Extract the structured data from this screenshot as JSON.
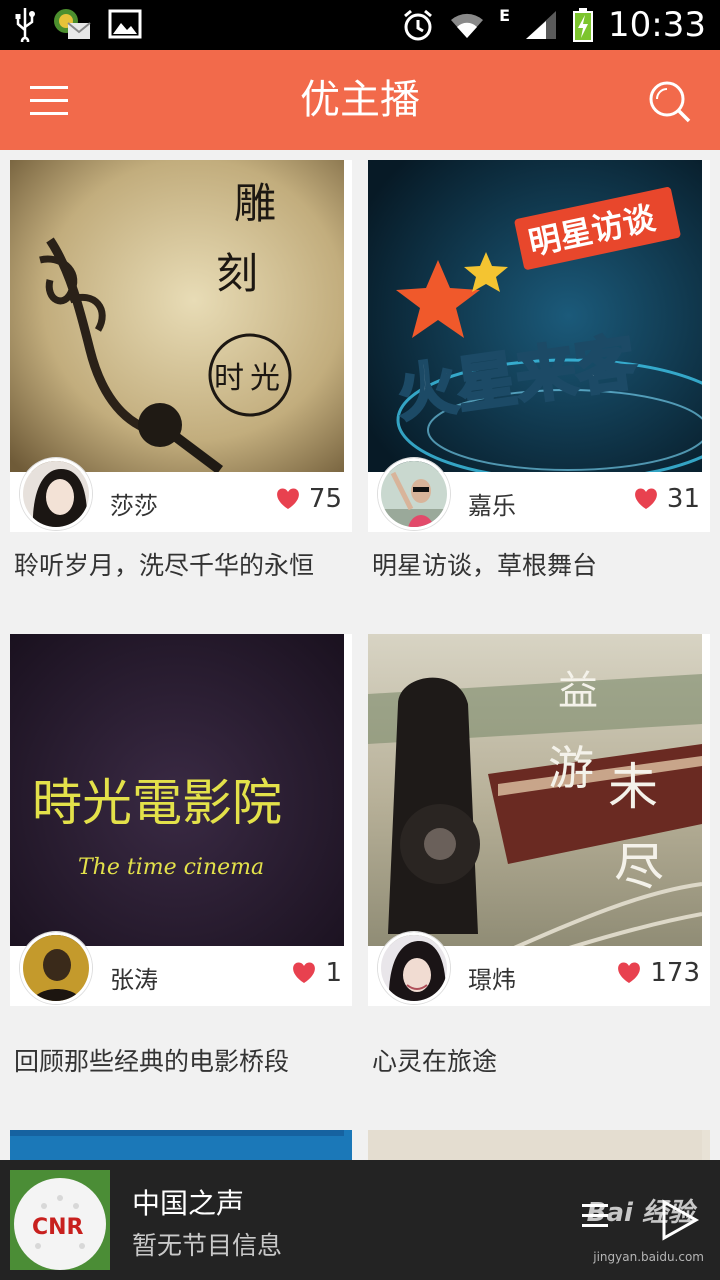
{
  "status_bar": {
    "time": "10:33",
    "network": "E",
    "icons": [
      "usb-icon",
      "mail-icon",
      "gallery-icon",
      "alarm-icon",
      "wifi-icon",
      "signal-icon",
      "battery-charging-icon"
    ]
  },
  "appbar": {
    "title": "优主播",
    "menu_icon": "hamburger-menu-icon",
    "search_icon": "search-icon",
    "color": "#f26a4b"
  },
  "cards": [
    {
      "cover_text": [
        "雕",
        "刻",
        "时",
        "光"
      ],
      "host": "莎莎",
      "likes": "75",
      "description": "聆听岁月，洗尽千华的永恒"
    },
    {
      "cover_text": [
        "明星访谈",
        "火星来客"
      ],
      "host": "嘉乐",
      "likes": "31",
      "description": "明星访谈，草根舞台"
    },
    {
      "cover_text": [
        "時光電影院",
        "The time cinema"
      ],
      "host": "张涛",
      "likes": "1",
      "description": "回顾那些经典的电影桥段"
    },
    {
      "cover_text": [
        "益",
        "游",
        "未",
        "尽"
      ],
      "host": "璟炜",
      "likes": "173",
      "description": "心灵在旅途"
    }
  ],
  "player": {
    "title": "中国之声",
    "subtitle": "暂无节目信息",
    "thumb_label": "CNR",
    "list_icon": "playlist-icon",
    "play_icon": "play-icon"
  },
  "watermark": {
    "logo": "Bai 经验",
    "url": "jingyan.baidu.com"
  },
  "colors": {
    "accent": "#f26a4b",
    "heart": "#e8414f",
    "player_bg": "#232323"
  }
}
